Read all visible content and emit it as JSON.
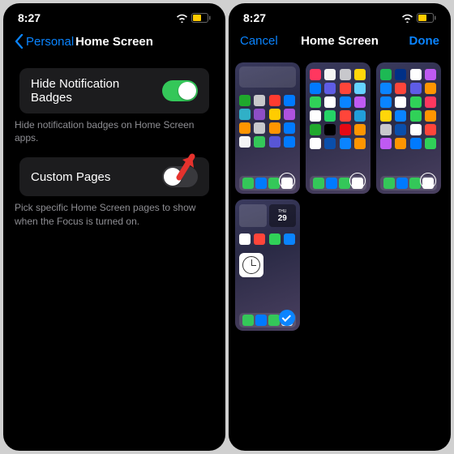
{
  "left": {
    "status_time": "8:27",
    "back_label": "Personal",
    "title": "Home Screen",
    "row1": {
      "label": "Hide Notification Badges",
      "footer": "Hide notification badges on Home Screen apps."
    },
    "row2": {
      "label": "Custom Pages",
      "footer": "Pick specific Home Screen pages to show when the Focus is turned on."
    }
  },
  "right": {
    "status_time": "8:27",
    "cancel": "Cancel",
    "title": "Home Screen",
    "done": "Done"
  },
  "colors": {
    "accent": "#0a84ff",
    "toggle_on": "#34c759"
  }
}
